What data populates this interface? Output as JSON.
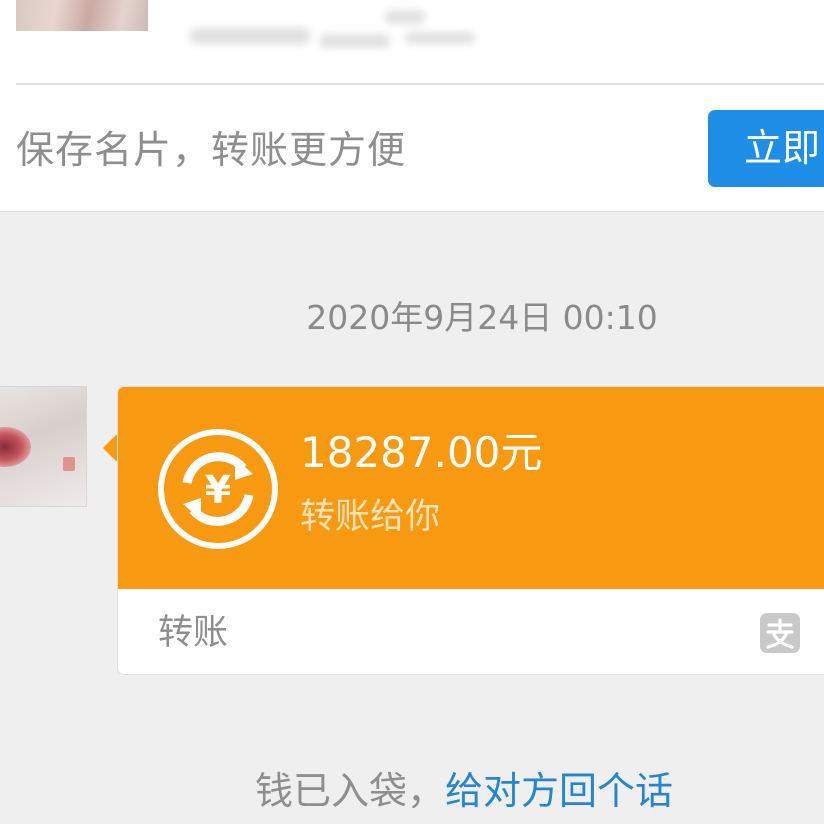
{
  "header": {
    "save_tip": "保存名片，转账更方便",
    "save_button": "立即"
  },
  "chat": {
    "timestamp": "2020年9月24日 00:10",
    "transfer": {
      "amount": "18287.00元",
      "subtitle": "转账给你",
      "footer_label": "转账",
      "icon": "yuan-transfer-icon",
      "badge_icon": "alipay-icon"
    }
  },
  "notice": {
    "prefix": "钱已入袋，",
    "link": "给对方回个话"
  },
  "colors": {
    "accent_blue": "#1f8ee6",
    "transfer_orange": "#f79a12",
    "link_blue": "#2585cf",
    "background": "#efefef"
  }
}
